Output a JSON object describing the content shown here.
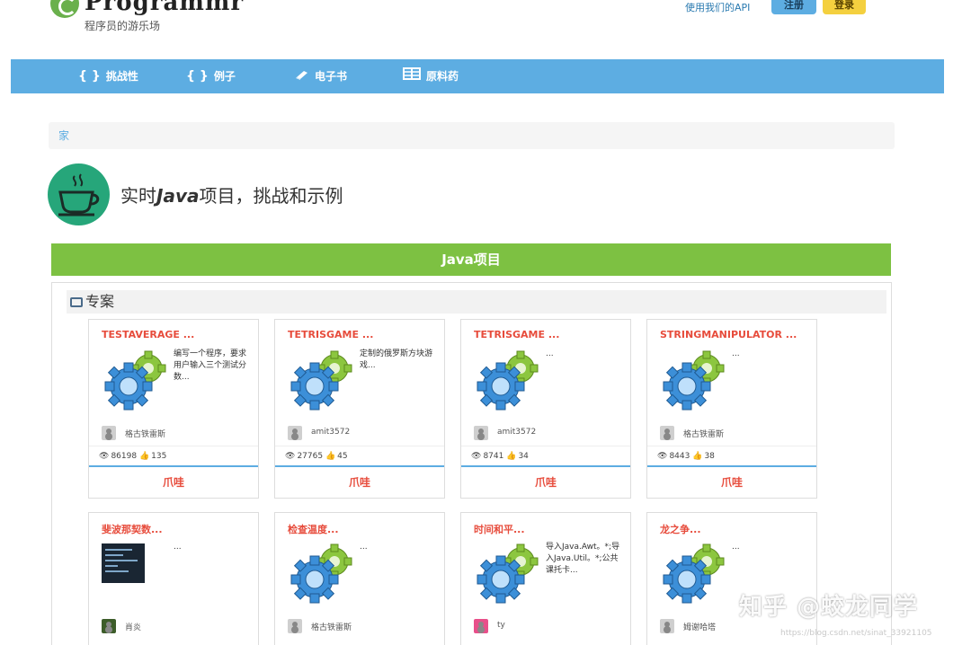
{
  "header": {
    "logo_text": "Programmr",
    "logo_sub": "程序员的游乐场",
    "api_link": "使用我们的API",
    "register": "注册",
    "login": "登录"
  },
  "nav": [
    {
      "label": "挑战性",
      "icon": "braces-icon"
    },
    {
      "label": "例子",
      "icon": "braces-icon"
    },
    {
      "label": "电子书",
      "icon": "book-icon"
    },
    {
      "label": "原料药",
      "icon": "table-icon"
    }
  ],
  "breadcrumb": "家",
  "page_title": {
    "pre": "实时",
    "bold": "Java",
    "post": "项目，挑战和示例"
  },
  "banner": "Java项目",
  "panel_title": "专案",
  "cards": [
    {
      "title": "TESTAVERAGE ...",
      "desc": "编写一个程序，要求用户输入三个测试分数...",
      "author": "格古铁雷斯",
      "views": "86198",
      "likes": "135",
      "button": "爪哇"
    },
    {
      "title": "TETRISGAME ...",
      "desc": "定制的俄罗斯方块游戏...",
      "author": "amit3572",
      "views": "27765",
      "likes": "45",
      "button": "爪哇"
    },
    {
      "title": "TETRISGAME ...",
      "desc": "...",
      "author": "amit3572",
      "views": "8741",
      "likes": "34",
      "button": "爪哇"
    },
    {
      "title": "STRINGMANIPULATOR ...",
      "desc": "...",
      "author": "格古铁雷斯",
      "views": "8443",
      "likes": "38",
      "button": "爪哇"
    },
    {
      "title": "斐波那契数...",
      "desc": "...",
      "author": "肖炎"
    },
    {
      "title": "检查温度...",
      "desc": "...",
      "author": "格古铁雷斯"
    },
    {
      "title": "时间和平...",
      "desc": "导入Java.Awt。*;导入Java.Util。*;公共课托卡...",
      "author": "ty"
    },
    {
      "title": "龙之争...",
      "desc": "...",
      "author": "姆谢哈塔"
    }
  ],
  "watermark": "知乎 @蛟龙同学",
  "watermark_url": "https://blog.csdn.net/sinat_33921105",
  "colors": {
    "nav": "#5dade2",
    "banner": "#7dc142",
    "title_red": "#e74c3c",
    "login_yellow": "#f4d03f"
  }
}
